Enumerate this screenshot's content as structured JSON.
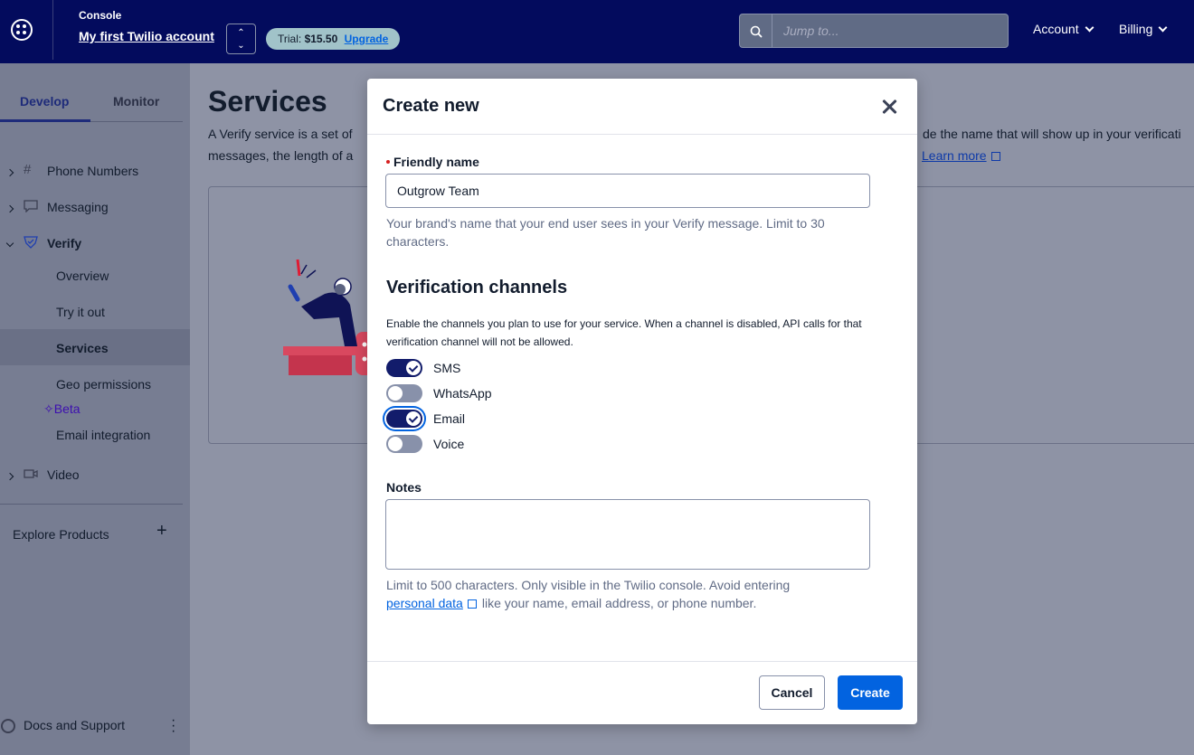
{
  "topbar": {
    "console_label": "Console",
    "account_name": "My first Twilio account",
    "trial_prefix": "Trial:",
    "trial_amount": "$15.50",
    "upgrade_label": "Upgrade",
    "search_placeholder": "Jump to...",
    "account_menu": "Account",
    "billing_menu": "Billing"
  },
  "sidebar": {
    "tabs": [
      {
        "label": "Develop",
        "active": true
      },
      {
        "label": "Monitor",
        "active": false
      }
    ],
    "items": [
      {
        "label": "Phone Numbers",
        "icon": "hash-icon"
      },
      {
        "label": "Messaging",
        "icon": "chat-icon"
      },
      {
        "label": "Verify",
        "icon": "shield-check-icon",
        "expanded": true
      },
      {
        "label": "Video",
        "icon": "video-icon"
      }
    ],
    "verify_sub": [
      "Overview",
      "Try it out",
      "Services",
      "Geo permissions",
      "Email integration"
    ],
    "active_sub": "Services",
    "beta_label": "Beta",
    "explore_label": "Explore Products",
    "docs_label": "Docs and Support"
  },
  "main": {
    "title": "Services",
    "description_start": "A Verify service is a set of",
    "description_line2_start": "messages, the length of a",
    "description_right": "de the name that will show up in your verificati",
    "learn_more": "Learn more"
  },
  "modal": {
    "title": "Create new",
    "friendly_name_label": "Friendly name",
    "friendly_name_value": "Outgrow Team",
    "friendly_name_help": "Your brand's name that your end user sees in your Verify message. Limit to 30 characters.",
    "channels_title": "Verification channels",
    "channels_desc": "Enable the channels you plan to use for your service. When a channel is disabled, API calls for that verification channel will not be allowed.",
    "channels": [
      {
        "label": "SMS",
        "enabled": true
      },
      {
        "label": "WhatsApp",
        "enabled": false
      },
      {
        "label": "Email",
        "enabled": true
      },
      {
        "label": "Voice",
        "enabled": false
      }
    ],
    "notes_label": "Notes",
    "notes_value": "",
    "notes_help_start": "Limit to 500 characters. Only visible in the Twilio console. Avoid entering",
    "notes_help_link": "personal data",
    "notes_help_end": "like your name, email address, or phone number.",
    "cancel_label": "Cancel",
    "create_label": "Create"
  },
  "colors": {
    "topbar_bg": "#030b5d",
    "primary_button": "#0263e0",
    "toggle_on": "#121c6b",
    "required_dot": "#d61f1f"
  }
}
